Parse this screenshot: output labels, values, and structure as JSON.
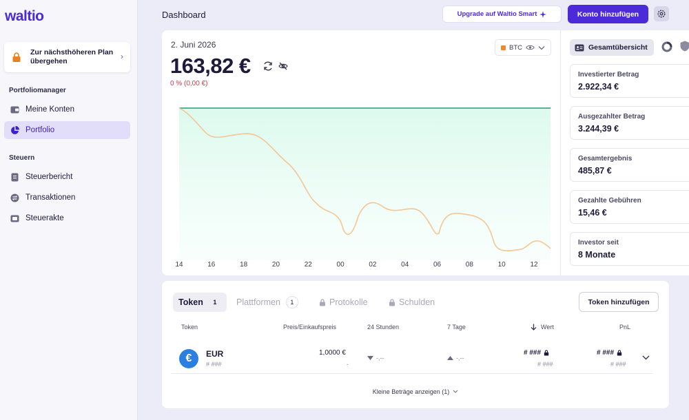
{
  "app": {
    "logo": "waltio"
  },
  "sidebar": {
    "plan_card": "Zur nächsthöheren Plan übergehen",
    "section_portfolio": "Portfoliomanager",
    "section_tax": "Steuern",
    "items": [
      {
        "label": "Meine Konten",
        "icon": "wallet-icon"
      },
      {
        "label": "Portfolio",
        "icon": "pie-chart-icon",
        "active": true
      },
      {
        "label": "Steuerbericht",
        "icon": "document-icon"
      },
      {
        "label": "Transaktionen",
        "icon": "transfer-icon"
      },
      {
        "label": "Steuerakte",
        "icon": "folder-icon"
      }
    ]
  },
  "header": {
    "title": "Dashboard",
    "upgrade_label": "Upgrade auf Waltio Smart",
    "add_account_label": "Konto hinzufügen"
  },
  "summary": {
    "date": "2. Juni 2026",
    "value": "163,82 €",
    "change": "0 % (0,00 €)",
    "currency_select": "BTC"
  },
  "chart_data": {
    "type": "line",
    "x_ticks": [
      "14",
      "16",
      "18",
      "20",
      "22",
      "00",
      "02",
      "04",
      "06",
      "08",
      "10",
      "12"
    ],
    "colors": {
      "reference": "#1E9E6E",
      "price": "#F3C99A",
      "fill": "#E2FBF2"
    }
  },
  "stats": {
    "overview_label": "Gesamtübersicht",
    "cards": [
      {
        "label": "Investierter Betrag",
        "value": "2.922,34 €"
      },
      {
        "label": "Ausgezahlter Betrag",
        "value": "3.244,39 €"
      },
      {
        "label": "Gesamtergebnis",
        "value": "485,87 €"
      },
      {
        "label": "Gezahlte Gebühren",
        "value": "15,46 €"
      },
      {
        "label": "Investor seit",
        "value": "8 Monate"
      }
    ]
  },
  "table": {
    "tabs": [
      {
        "label": "Token",
        "count": "1"
      },
      {
        "label": "Plattformen",
        "count": "1"
      },
      {
        "label": "Protokolle"
      },
      {
        "label": "Schulden"
      }
    ],
    "add_token_label": "Token hinzufügen",
    "headers": {
      "token": "Token",
      "price": "Preis/Einkaufspreis",
      "h24": "24 Stunden",
      "d7": "7 Tage",
      "value": "Wert",
      "pnl": "PnL"
    },
    "rows": [
      {
        "symbol": "EUR",
        "sub": "# ###",
        "price": "1,0000 €",
        "purchase": "-",
        "h24": "-,--",
        "d7": "-,--",
        "value": "# ###",
        "value_sub": "# ###",
        "pnl": "# ###",
        "pnl_sub": "# ###"
      }
    ],
    "small_amounts_label": "Kleine Beträge anzeigen (1)"
  }
}
